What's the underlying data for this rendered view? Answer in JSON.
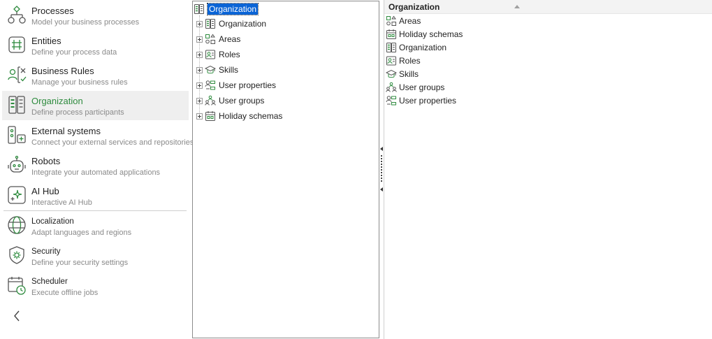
{
  "nav": {
    "items": [
      {
        "title": "Processes",
        "subtitle": "Model your business processes",
        "icon": "process-flow-icon"
      },
      {
        "title": "Entities",
        "subtitle": "Define your process data",
        "icon": "entity-grid-icon"
      },
      {
        "title": "Business Rules",
        "subtitle": "Manage your business rules",
        "icon": "business-rules-icon"
      },
      {
        "title": "Organization",
        "subtitle": "Define process participants",
        "icon": "organization-icon"
      },
      {
        "title": "External systems",
        "subtitle": "Connect your external services and repositories",
        "icon": "external-systems-icon"
      },
      {
        "title": "Robots",
        "subtitle": "Integrate your automated applications",
        "icon": "robot-icon"
      },
      {
        "title": "AI Hub",
        "subtitle": "Interactive AI Hub",
        "icon": "ai-sparkle-icon"
      },
      {
        "title": "Localization",
        "subtitle": "Adapt languages and regions",
        "icon": "globe-icon"
      },
      {
        "title": "Security",
        "subtitle": "Define your security settings",
        "icon": "security-gear-icon"
      },
      {
        "title": "Scheduler",
        "subtitle": "Execute offline jobs",
        "icon": "scheduler-clock-icon"
      }
    ],
    "active_index": 3,
    "collapse_icon": "chevron-left-icon"
  },
  "tree": {
    "root": {
      "label": "Organization",
      "icon": "organization-icon"
    },
    "children": [
      {
        "label": "Organization",
        "icon": "organization-icon"
      },
      {
        "label": "Areas",
        "icon": "areas-icon"
      },
      {
        "label": "Roles",
        "icon": "roles-icon"
      },
      {
        "label": "Skills",
        "icon": "skills-icon"
      },
      {
        "label": "User properties",
        "icon": "user-properties-icon"
      },
      {
        "label": "User groups",
        "icon": "user-groups-icon"
      },
      {
        "label": "Holiday schemas",
        "icon": "holiday-calendar-icon"
      }
    ]
  },
  "list": {
    "header": "Organization",
    "rows": [
      {
        "label": "Areas",
        "icon": "areas-icon"
      },
      {
        "label": "Holiday schemas",
        "icon": "holiday-calendar-icon"
      },
      {
        "label": "Organization",
        "icon": "organization-icon"
      },
      {
        "label": "Roles",
        "icon": "roles-icon"
      },
      {
        "label": "Skills",
        "icon": "skills-icon"
      },
      {
        "label": "User groups",
        "icon": "user-groups-icon"
      },
      {
        "label": "User properties",
        "icon": "user-properties-icon"
      }
    ]
  },
  "colors": {
    "accent": "#2e8b3e",
    "selection": "#0a64d6",
    "icon_gray": "#555555"
  }
}
